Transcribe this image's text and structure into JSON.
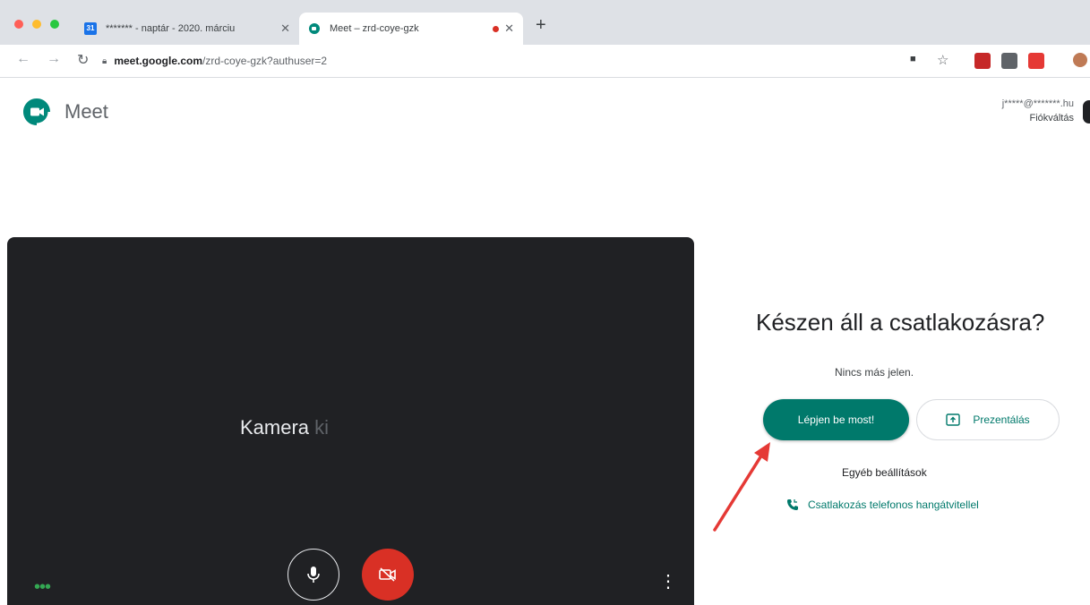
{
  "browser": {
    "tabs": [
      {
        "title": "******* - naptár - 2020. márciu",
        "close": "✕",
        "favicon": "calendar-icon",
        "favicon_text": "31"
      },
      {
        "title": "Meet – zrd-coye-gzk",
        "close": "✕",
        "favicon": "meet-icon"
      }
    ],
    "new_tab": "+",
    "url_host": "meet.google.com",
    "url_path": "/zrd-coye-gzk?authuser=2"
  },
  "header": {
    "app_name": "Meet",
    "account_email": "j*****@*******.hu",
    "switch_account": "Fiókváltás"
  },
  "preview": {
    "camera_status_visible": "Kamera",
    "camera_status_faded": "ki"
  },
  "join_panel": {
    "title": "Készen áll a csatlakozásra?",
    "nobody_here": "Nincs más jelen.",
    "join_button": "Lépjen be most!",
    "present_button": "Prezentálás",
    "other_options": "Egyéb beállítások",
    "phone_join": "Csatlakozás telefonos hangátvitellel"
  },
  "colors": {
    "accent": "#00796b",
    "camera_off": "#d93025",
    "preview_bg": "#202124",
    "annotation_arrow": "#e53935"
  }
}
